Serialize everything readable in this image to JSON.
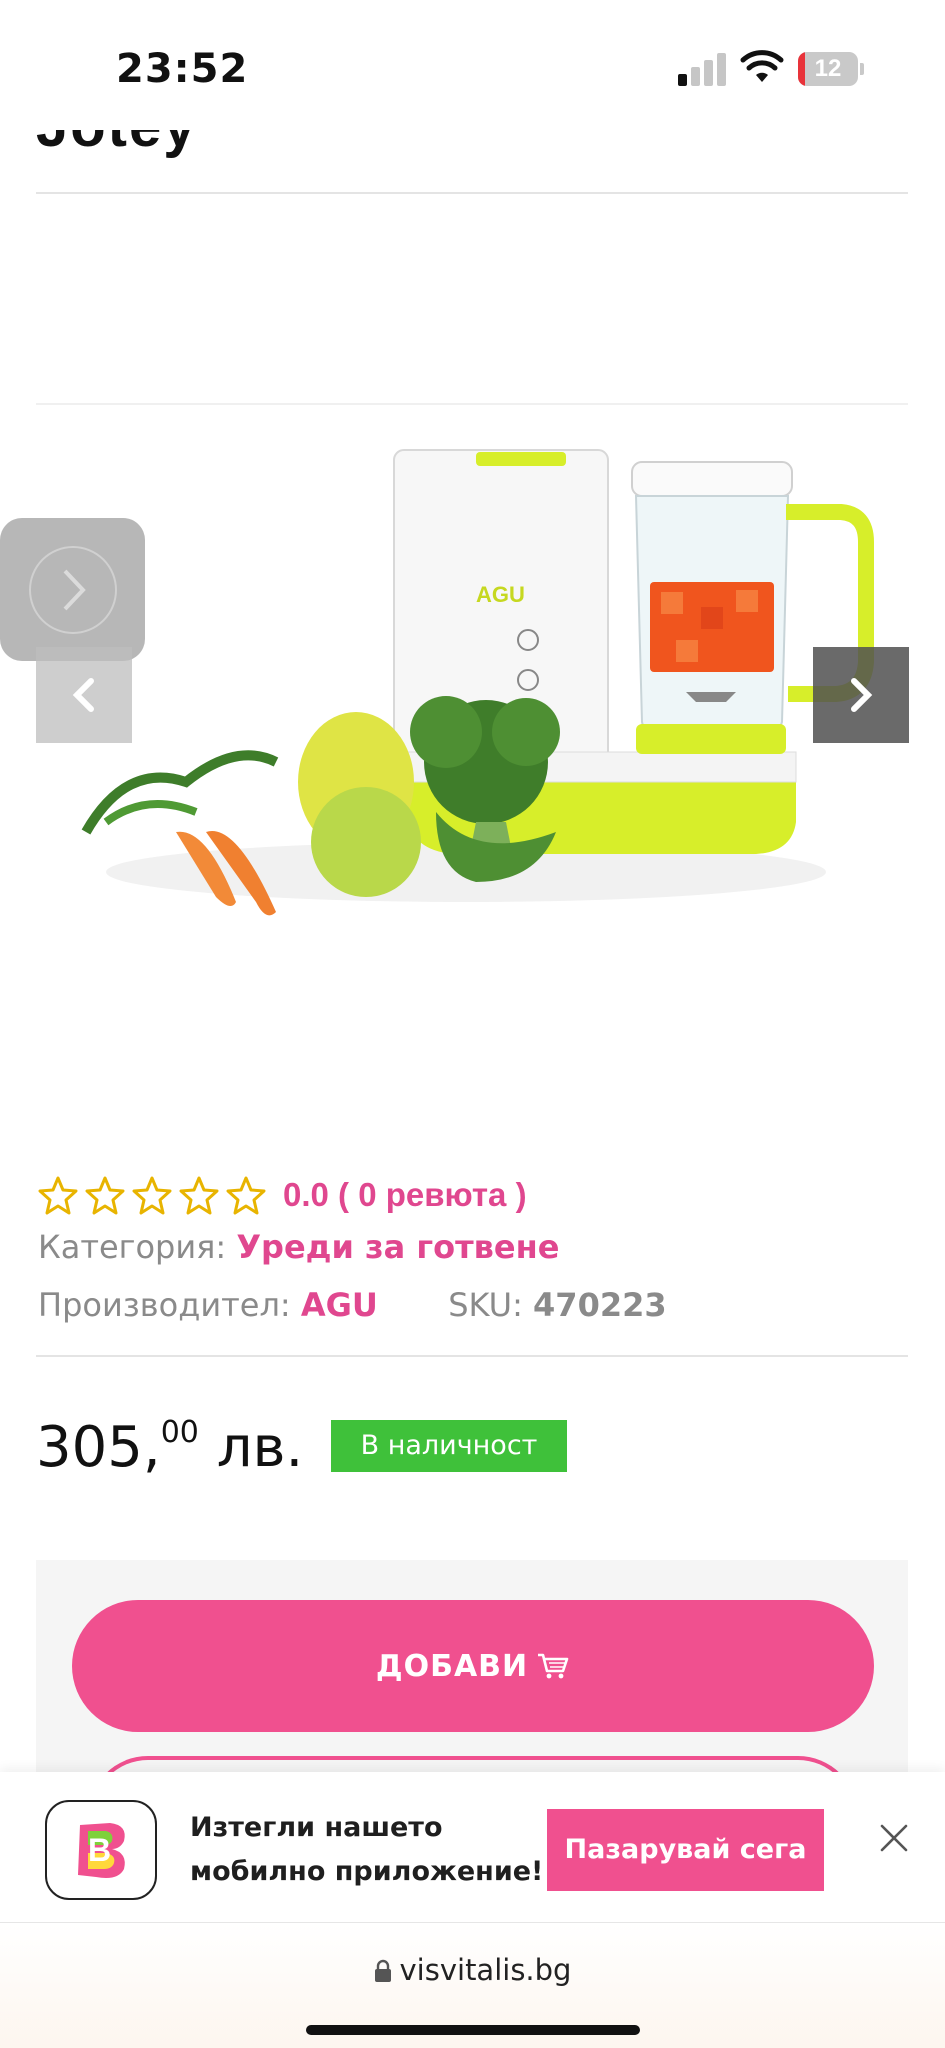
{
  "status_bar": {
    "time": "23:52",
    "battery": "12",
    "battery_level": 0.12
  },
  "page": {
    "title_fragment": "Jotey",
    "title_icon": "product-image"
  },
  "gallery": {
    "prev_icon": "chevron-left-icon",
    "next_icon": "chevron-right-icon",
    "floating_icon": "chevron-right-icon",
    "brand_on_device": "AGU"
  },
  "product": {
    "rating_value": "0.0 ( 0 ревюта )",
    "stars": 0,
    "category_label": "Категория:",
    "category_value": "Уреди за готвене",
    "manufacturer_label": "Производител:",
    "manufacturer_value": "AGU",
    "sku_label": "SKU:",
    "sku_value": "470223",
    "price_main": "305,",
    "price_cents": "00",
    "price_currency": "лв.",
    "stock_status": "В наличност",
    "add_button": "ДОБАВИ",
    "cart_icon": "cart-icon"
  },
  "app_banner": {
    "text_line1": "Изтегли нашето",
    "text_line2": "мобилно приложение!",
    "shop_button": "Пазарувай сега",
    "close_icon": "close-icon",
    "app_logo": "B"
  },
  "browser": {
    "url": "visvitalis.bg"
  },
  "colors": {
    "accent": "#f0508f",
    "stock_green": "#3fc13a",
    "star_yellow": "#e8b400"
  }
}
